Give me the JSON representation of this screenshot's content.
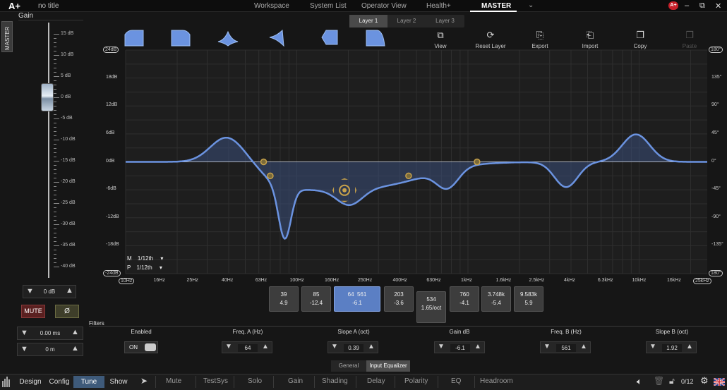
{
  "app": {
    "logo": "A+",
    "title": "no title",
    "badge": "A+"
  },
  "nav": {
    "items": [
      "Workspace",
      "System List",
      "Operator View",
      "Health+",
      "MASTER"
    ],
    "active": "MASTER"
  },
  "window": {
    "minimize": "–",
    "restore": "⧉",
    "close": "✕"
  },
  "left": {
    "tab_label": "MASTER",
    "gain_label": "Gain",
    "fader_scale": [
      "15 dB",
      "10 dB",
      "5 dB",
      "0 dB",
      "-5 dB",
      "-10 dB",
      "-15 dB",
      "-20 dB",
      "-25 dB",
      "-30 dB",
      "-35 dB",
      "-40 dB"
    ],
    "gain_value": "0 dB",
    "mute_label": "MUTE",
    "phase_label": "Ø",
    "delay_ms": "0.00 ms",
    "delay_m": "0 m"
  },
  "layers": {
    "tabs": [
      "Layer 1",
      "Layer 2",
      "Layer 3"
    ],
    "active": "Layer 1"
  },
  "filter_shapes": [
    "low-shelf-icon",
    "high-shelf-icon",
    "bell-icon",
    "notch-icon",
    "band-pass-icon",
    "high-cut-icon"
  ],
  "toolbar": {
    "view": "View",
    "reset": "Reset Layer",
    "export": "Export",
    "import": "Import",
    "copy": "Copy",
    "paste": "Paste"
  },
  "graph": {
    "y_left": [
      "24dB",
      "18dB",
      "12dB",
      "6dB",
      "0dB",
      "-6dB",
      "-12dB",
      "-18dB",
      "-24dB"
    ],
    "y_right": [
      "180°",
      "135°",
      "90°",
      "45°",
      "0°",
      "-45°",
      "-90°",
      "-135°",
      "180°"
    ],
    "x_labels": [
      "10Hz",
      "16Hz",
      "25Hz",
      "40Hz",
      "63Hz",
      "100Hz",
      "160Hz",
      "250Hz",
      "400Hz",
      "630Hz",
      "1kHz",
      "1.6kHz",
      "2.5kHz",
      "4kHz",
      "6.3kHz",
      "10kHz",
      "16kHz",
      "25kHz"
    ],
    "smoothing": {
      "m_label": "M",
      "m_value": "1/12th",
      "p_label": "P",
      "p_value": "1/12th"
    },
    "colors": {
      "curve": "#6b93e0",
      "fill": "#3a4f7a",
      "node": "#c8a24a"
    }
  },
  "bands": [
    {
      "top": "39",
      "bottom": "4.9"
    },
    {
      "top": "85",
      "bottom": "-12.4"
    },
    {
      "top": "64  561",
      "bottom": "-6.1",
      "selected": true
    },
    {
      "top": "203",
      "bottom": "-3.6"
    },
    {
      "top": "534",
      "bottom": "1.65/oct"
    },
    {
      "top": "760",
      "bottom": "-4.1"
    },
    {
      "top": "3.748k",
      "bottom": "-5.4"
    },
    {
      "top": "9.583k",
      "bottom": "5.9"
    }
  ],
  "filters": {
    "section_label": "Filters",
    "headers": [
      "Enabled",
      "Freq. A (Hz)",
      "Slope A (oct)",
      "Gain dB",
      "Freq. B (Hz)",
      "Slope B (oct)"
    ],
    "enabled": "ON",
    "freq_a": "64",
    "slope_a": "0.39",
    "gain": "-6.1",
    "freq_b": "561",
    "slope_b": "1.92"
  },
  "subtabs": {
    "items": [
      "General",
      "Input Equalizer"
    ],
    "active": "Input Equalizer"
  },
  "bottom": {
    "modes": [
      "Design",
      "Config",
      "Tune",
      "Show"
    ],
    "active_mode": "Tune",
    "functions": [
      "Mute",
      "TestSys",
      "Solo",
      "Gain",
      "Shading",
      "Delay",
      "Polarity",
      "EQ",
      "Headroom"
    ],
    "counter": "0/12",
    "accent": "#3e5a7a"
  }
}
